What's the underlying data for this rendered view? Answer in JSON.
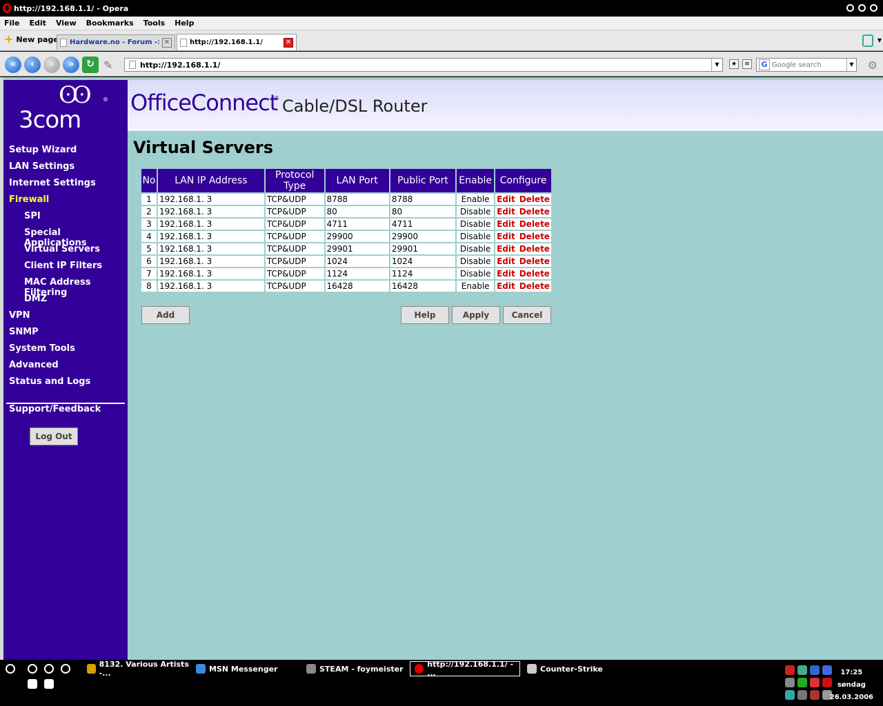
{
  "browser": {
    "window_title": "http://192.168.1.1/ - Opera",
    "menu": [
      "File",
      "Edit",
      "View",
      "Bookmarks",
      "Tools",
      "Help"
    ],
    "new_page": "New page",
    "tabs": [
      {
        "label": "Hardware.no - Forum -> ..."
      },
      {
        "label": "http://192.168.1.1/"
      }
    ],
    "address": "http://192.168.1.1/",
    "search_placeholder": "Google search"
  },
  "router": {
    "logo_text": "3com",
    "product": "OfficeConnect",
    "product_sub": "Cable/DSL Router",
    "nav": [
      {
        "label": "Setup Wizard"
      },
      {
        "label": "LAN Settings"
      },
      {
        "label": "Internet Settings"
      },
      {
        "label": "Firewall"
      },
      {
        "label": "SPI"
      },
      {
        "label": "Special Applications"
      },
      {
        "label": "Virtual Servers"
      },
      {
        "label": "Client IP Filters"
      },
      {
        "label": "MAC Address Filtering"
      },
      {
        "label": "DMZ"
      },
      {
        "label": "VPN"
      },
      {
        "label": "SNMP"
      },
      {
        "label": "System Tools"
      },
      {
        "label": "Advanced"
      },
      {
        "label": "Status and Logs"
      }
    ],
    "support": "Support/Feedback",
    "logout": "Log Out",
    "page_title": "Virtual Servers",
    "table": {
      "headers": [
        "No",
        "LAN IP Address",
        "Protocol Type",
        "LAN Port",
        "Public Port",
        "Enable",
        "Configure"
      ],
      "edit": "Edit",
      "delete": "Delete",
      "rows": [
        {
          "no": "1",
          "ip": "192.168.1. 3",
          "proto": "TCP&UDP",
          "lan": "8788",
          "pub": "8788",
          "enable": "Enable"
        },
        {
          "no": "2",
          "ip": "192.168.1. 3",
          "proto": "TCP&UDP",
          "lan": "80",
          "pub": "80",
          "enable": "Disable"
        },
        {
          "no": "3",
          "ip": "192.168.1. 3",
          "proto": "TCP&UDP",
          "lan": "4711",
          "pub": "4711",
          "enable": "Disable"
        },
        {
          "no": "4",
          "ip": "192.168.1. 3",
          "proto": "TCP&UDP",
          "lan": "29900",
          "pub": "29900",
          "enable": "Disable"
        },
        {
          "no": "5",
          "ip": "192.168.1. 3",
          "proto": "TCP&UDP",
          "lan": "29901",
          "pub": "29901",
          "enable": "Disable"
        },
        {
          "no": "6",
          "ip": "192.168.1. 3",
          "proto": "TCP&UDP",
          "lan": "1024",
          "pub": "1024",
          "enable": "Disable"
        },
        {
          "no": "7",
          "ip": "192.168.1. 3",
          "proto": "TCP&UDP",
          "lan": "1124",
          "pub": "1124",
          "enable": "Disable"
        },
        {
          "no": "8",
          "ip": "192.168.1. 3",
          "proto": "TCP&UDP",
          "lan": "16428",
          "pub": "16428",
          "enable": "Enable"
        }
      ]
    },
    "buttons": {
      "add": "Add",
      "help": "Help",
      "apply": "Apply",
      "cancel": "Cancel"
    }
  },
  "taskbar": {
    "tasks": [
      {
        "label": "8132. Various Artists -..."
      },
      {
        "label": "MSN Messenger"
      },
      {
        "label": "STEAM - foymeister"
      },
      {
        "label": "http://192.168.1.1/ - ..."
      },
      {
        "label": "Counter-Strike"
      }
    ],
    "time": "17:25",
    "day": "søndag",
    "date": "26.03.2006"
  },
  "colors": {
    "sidebar": "#330099",
    "page_bg": "#9fcfcf",
    "active_nav": "#ffff33",
    "link_red": "#cc0000"
  }
}
